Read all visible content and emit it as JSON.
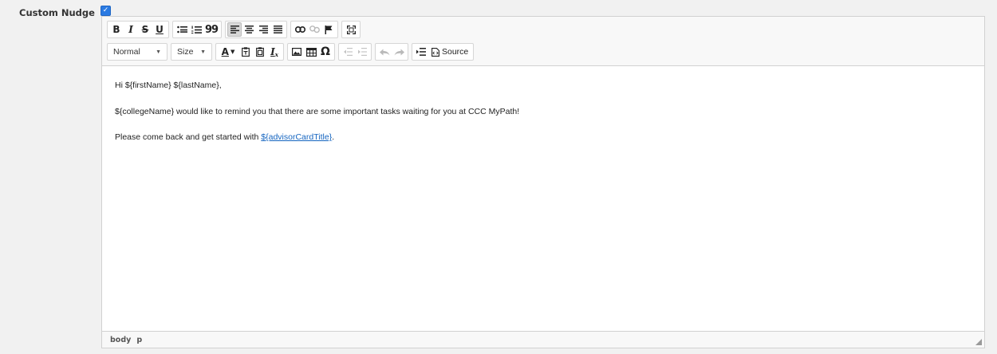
{
  "field": {
    "label": "Custom Nudge",
    "checkbox_checked": true,
    "check_glyph": "✓"
  },
  "toolbar": {
    "row1": {
      "basic": [
        "B",
        "I",
        "S",
        "U"
      ],
      "lists_icon_names": [
        "bulleted-list-icon",
        "numbered-list-icon"
      ],
      "quote": "99",
      "align_icon_names": [
        "align-left-icon",
        "align-center-icon",
        "align-right-icon",
        "justify-icon"
      ],
      "links_icon_names": [
        "link-icon",
        "unlink-icon",
        "anchor-flag-icon"
      ],
      "maximize_icon": "maximize-icon"
    },
    "row2": {
      "format_combo": "Normal",
      "size_combo": "Size",
      "text_color": "A",
      "remove_format": "I",
      "special_char": "Ω",
      "source_label": "Source"
    }
  },
  "content": {
    "line1": "Hi ${firstName} ${lastName},",
    "line2": "${collegeName} would like to remind you that there are some important tasks waiting for you at CCC MyPath!",
    "line3_prefix": "Please come back and get started with ",
    "line3_link": "${advisorCardTitle}",
    "line3_suffix": "."
  },
  "statusbar": {
    "path": [
      "body",
      "p"
    ]
  },
  "colors": {
    "accent": "#2a7ae2",
    "link": "#1565c0",
    "page_bg": "#f1f1f1"
  }
}
